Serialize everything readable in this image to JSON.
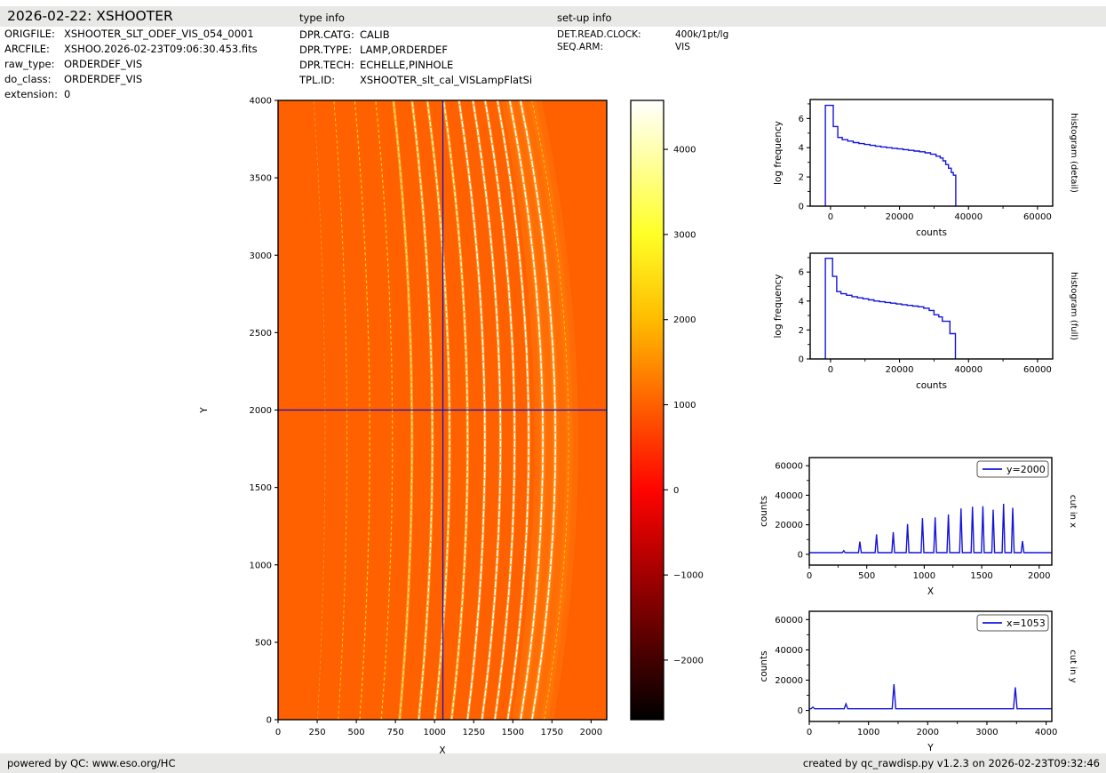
{
  "header": {
    "title": "2026-02-22: XSHOOTER",
    "type_info_title": "type info",
    "setup_info_title": "set-up info"
  },
  "file_info": [
    {
      "label": "ORIGFILE:",
      "value": "XSHOOTER_SLT_ODEF_VIS_054_0001"
    },
    {
      "label": "ARCFILE:",
      "value": "XSHOO.2026-02-23T09:06:30.453.fits"
    },
    {
      "label": "raw_type:",
      "value": "ORDERDEF_VIS"
    },
    {
      "label": "do_class:",
      "value": "ORDERDEF_VIS"
    },
    {
      "label": "extension:",
      "value": "0"
    }
  ],
  "type_info": [
    {
      "label": "DPR.CATG:",
      "value": "CALIB"
    },
    {
      "label": "DPR.TYPE:",
      "value": "LAMP,ORDERDEF"
    },
    {
      "label": "DPR.TECH:",
      "value": "ECHELLE,PINHOLE"
    },
    {
      "label": "TPL.ID:",
      "value": "XSHOOTER_slt_cal_VISLampFlatSi"
    }
  ],
  "setup_info": [
    {
      "label": "DET.READ.CLOCK:",
      "value": "400k/1pt/lg"
    },
    {
      "label": "SEQ.ARM:",
      "value": "VIS"
    }
  ],
  "footer": {
    "left": "powered by QC: www.eso.org/HC",
    "right": "created by qc_rawdisp.py v1.2.3 on 2026-02-23T09:32:46"
  },
  "colors": {
    "curve_blue": "#1414dc",
    "crosshair_blue": "#0a10c8",
    "image_background": "#ff6000",
    "strip_gray": "#e8e8e7",
    "glow_yellow": "#ffd24d",
    "halo_orange": "#ff7a10"
  },
  "chart_data": [
    {
      "id": "main_image",
      "type": "heatmap",
      "xlabel": "X",
      "ylabel": "Y",
      "xlim": [
        0,
        2100
      ],
      "ylim": [
        0,
        4000
      ],
      "xticks": [
        0,
        250,
        500,
        750,
        1000,
        1250,
        1500,
        1750,
        2000
      ],
      "yticks": [
        0,
        500,
        1000,
        1500,
        2000,
        2500,
        3000,
        3500,
        4000
      ],
      "background_value": 1000,
      "crosshair": {
        "x": 1053,
        "y": 2000
      },
      "order_vertex_y": 1800,
      "orders": [
        {
          "x_at_y2000": 300,
          "x_shift_at_edges": 72,
          "peak_counts": 2500
        },
        {
          "x_at_y2000": 440,
          "x_shift_at_edges": 83,
          "peak_counts": 8600
        },
        {
          "x_at_y2000": 585,
          "x_shift_at_edges": 95,
          "peak_counts": 13500
        },
        {
          "x_at_y2000": 730,
          "x_shift_at_edges": 106,
          "peak_counts": 15000
        },
        {
          "x_at_y2000": 855,
          "x_shift_at_edges": 118,
          "peak_counts": 20500
        },
        {
          "x_at_y2000": 985,
          "x_shift_at_edges": 129,
          "peak_counts": 24500
        },
        {
          "x_at_y2000": 1095,
          "x_shift_at_edges": 141,
          "peak_counts": 25000
        },
        {
          "x_at_y2000": 1210,
          "x_shift_at_edges": 152,
          "peak_counts": 27000
        },
        {
          "x_at_y2000": 1320,
          "x_shift_at_edges": 164,
          "peak_counts": 31000
        },
        {
          "x_at_y2000": 1420,
          "x_shift_at_edges": 175,
          "peak_counts": 32200
        },
        {
          "x_at_y2000": 1510,
          "x_shift_at_edges": 187,
          "peak_counts": 32500
        },
        {
          "x_at_y2000": 1600,
          "x_shift_at_edges": 198,
          "peak_counts": 30200
        },
        {
          "x_at_y2000": 1690,
          "x_shift_at_edges": 210,
          "peak_counts": 34200
        },
        {
          "x_at_y2000": 1770,
          "x_shift_at_edges": 221,
          "peak_counts": 31500
        },
        {
          "x_at_y2000": 1855,
          "x_shift_at_edges": 233,
          "peak_counts": 9000
        }
      ]
    },
    {
      "id": "colorbar",
      "type": "colorbar",
      "vmin": -2700,
      "vmax": 4575,
      "ticks": [
        4000,
        3000,
        2000,
        1000,
        0,
        -1000,
        -2000
      ],
      "colormap": "hot",
      "stops": [
        [
          "#ffffff",
          0
        ],
        [
          "#ffffb0",
          0.079
        ],
        [
          "#ffff26",
          0.216
        ],
        [
          "#ffbc00",
          0.354
        ],
        [
          "#ff6000",
          0.491
        ],
        [
          "#ff0400",
          0.629
        ],
        [
          "#a30000",
          0.766
        ],
        [
          "#430000",
          0.904
        ],
        [
          "#000000",
          1
        ]
      ]
    },
    {
      "id": "histogram_detail",
      "type": "line",
      "style": "steps",
      "right_label": "histogram (detail)",
      "xlabel": "counts",
      "ylabel": "log frequency",
      "xlim": [
        -5900,
        64400
      ],
      "ylim": [
        0,
        7.3
      ],
      "xticks": [
        0,
        20000,
        40000,
        60000
      ],
      "xticks_minor": [
        10000,
        30000,
        50000
      ],
      "yticks": [
        0,
        2,
        4,
        6
      ],
      "yticks_minor": [
        1,
        3,
        5,
        7
      ],
      "poly": [
        [
          -1500,
          0
        ],
        [
          -1500,
          6.9
        ],
        [
          800,
          6.9
        ],
        [
          800,
          5.45
        ],
        [
          2100,
          5.45
        ],
        [
          2100,
          4.7
        ],
        [
          3400,
          4.7
        ],
        [
          3400,
          4.55
        ],
        [
          5000,
          4.55
        ],
        [
          5000,
          4.45
        ],
        [
          6600,
          4.45
        ],
        [
          6600,
          4.35
        ],
        [
          8200,
          4.35
        ],
        [
          8200,
          4.28
        ],
        [
          9800,
          4.28
        ],
        [
          9800,
          4.22
        ],
        [
          11400,
          4.22
        ],
        [
          11400,
          4.16
        ],
        [
          13000,
          4.16
        ],
        [
          13000,
          4.1
        ],
        [
          14600,
          4.1
        ],
        [
          14600,
          4.05
        ],
        [
          16200,
          4.05
        ],
        [
          16200,
          4.0
        ],
        [
          17800,
          4.0
        ],
        [
          17800,
          3.96
        ],
        [
          19400,
          3.96
        ],
        [
          19400,
          3.92
        ],
        [
          21000,
          3.92
        ],
        [
          21000,
          3.87
        ],
        [
          22600,
          3.87
        ],
        [
          22600,
          3.82
        ],
        [
          24200,
          3.82
        ],
        [
          24200,
          3.77
        ],
        [
          25800,
          3.77
        ],
        [
          25800,
          3.72
        ],
        [
          27400,
          3.72
        ],
        [
          27400,
          3.65
        ],
        [
          29000,
          3.65
        ],
        [
          29000,
          3.55
        ],
        [
          30600,
          3.55
        ],
        [
          30600,
          3.42
        ],
        [
          31800,
          3.42
        ],
        [
          31800,
          3.3
        ],
        [
          32600,
          3.3
        ],
        [
          32600,
          3.1
        ],
        [
          33400,
          3.1
        ],
        [
          33400,
          2.85
        ],
        [
          34200,
          2.85
        ],
        [
          34200,
          2.6
        ],
        [
          35000,
          2.6
        ],
        [
          35000,
          2.3
        ],
        [
          35600,
          2.3
        ],
        [
          35600,
          2.12
        ],
        [
          36300,
          2.12
        ],
        [
          36300,
          0
        ]
      ]
    },
    {
      "id": "histogram_full",
      "type": "line",
      "style": "steps",
      "right_label": "histogram (full)",
      "xlabel": "counts",
      "ylabel": "log frequency",
      "xlim": [
        -5900,
        64400
      ],
      "ylim": [
        0,
        7.3
      ],
      "xticks": [
        0,
        20000,
        40000,
        60000
      ],
      "xticks_minor": [
        10000,
        30000,
        50000
      ],
      "yticks": [
        0,
        2,
        4,
        6
      ],
      "yticks_minor": [
        1,
        3,
        5,
        7
      ],
      "poly": [
        [
          -1500,
          0
        ],
        [
          -1500,
          6.95
        ],
        [
          600,
          6.95
        ],
        [
          600,
          5.7
        ],
        [
          1800,
          5.7
        ],
        [
          1800,
          4.65
        ],
        [
          3000,
          4.65
        ],
        [
          3000,
          4.5
        ],
        [
          4600,
          4.5
        ],
        [
          4600,
          4.4
        ],
        [
          6200,
          4.4
        ],
        [
          6200,
          4.3
        ],
        [
          7800,
          4.3
        ],
        [
          7800,
          4.22
        ],
        [
          9400,
          4.22
        ],
        [
          9400,
          4.15
        ],
        [
          11000,
          4.15
        ],
        [
          11000,
          4.08
        ],
        [
          12600,
          4.08
        ],
        [
          12600,
          4.0
        ],
        [
          14200,
          4.0
        ],
        [
          14200,
          3.95
        ],
        [
          15800,
          3.95
        ],
        [
          15800,
          3.9
        ],
        [
          17400,
          3.9
        ],
        [
          17400,
          3.85
        ],
        [
          19000,
          3.85
        ],
        [
          19000,
          3.8
        ],
        [
          20600,
          3.8
        ],
        [
          20600,
          3.75
        ],
        [
          22200,
          3.75
        ],
        [
          22200,
          3.7
        ],
        [
          23800,
          3.7
        ],
        [
          23800,
          3.65
        ],
        [
          25400,
          3.65
        ],
        [
          25400,
          3.6
        ],
        [
          27000,
          3.6
        ],
        [
          27000,
          3.5
        ],
        [
          28600,
          3.5
        ],
        [
          28600,
          3.35
        ],
        [
          30000,
          3.35
        ],
        [
          30000,
          3.05
        ],
        [
          31400,
          3.05
        ],
        [
          31400,
          2.9
        ],
        [
          32400,
          2.9
        ],
        [
          32400,
          2.6
        ],
        [
          34600,
          2.6
        ],
        [
          34600,
          1.75
        ],
        [
          36200,
          1.75
        ],
        [
          36200,
          0
        ]
      ]
    },
    {
      "id": "cut_in_x",
      "type": "line",
      "right_label": "cut in x",
      "xlabel": "X",
      "ylabel": "counts",
      "legend": {
        "label": "y=2000",
        "position": "upper right"
      },
      "xlim": [
        0,
        2110
      ],
      "ylim": [
        -7300,
        65500
      ],
      "xticks": [
        0,
        500,
        1000,
        1500,
        2000
      ],
      "xticks_minor": [
        250,
        750,
        1250,
        1750
      ],
      "yticks": [
        0,
        20000,
        40000,
        60000
      ],
      "yticks_minor": [
        10000,
        30000,
        50000
      ],
      "baseline": 1100,
      "spike_halfwidth": 12,
      "spikes": [
        [
          300,
          2500
        ],
        [
          440,
          8600
        ],
        [
          585,
          13500
        ],
        [
          730,
          15000
        ],
        [
          855,
          20500
        ],
        [
          985,
          24500
        ],
        [
          1095,
          25000
        ],
        [
          1210,
          27000
        ],
        [
          1320,
          31000
        ],
        [
          1420,
          32200
        ],
        [
          1510,
          32500
        ],
        [
          1600,
          30200
        ],
        [
          1690,
          34200
        ],
        [
          1770,
          31500
        ],
        [
          1855,
          9000
        ]
      ]
    },
    {
      "id": "cut_in_y",
      "type": "line",
      "right_label": "cut in y",
      "xlabel": "Y",
      "ylabel": "counts",
      "legend": {
        "label": "x=1053",
        "position": "upper right"
      },
      "xlim": [
        0,
        4096
      ],
      "ylim": [
        -7300,
        65500
      ],
      "xticks": [
        0,
        1000,
        2000,
        3000,
        4000
      ],
      "xticks_minor": [
        500,
        1500,
        2500,
        3500
      ],
      "yticks": [
        0,
        20000,
        40000,
        60000
      ],
      "yticks_minor": [
        10000,
        30000,
        50000
      ],
      "baseline": 1100,
      "spike_halfwidth": 30,
      "spikes": [
        [
          60,
          2200
        ],
        [
          620,
          4300
        ],
        [
          1430,
          17300
        ],
        [
          3480,
          15300
        ]
      ]
    }
  ]
}
